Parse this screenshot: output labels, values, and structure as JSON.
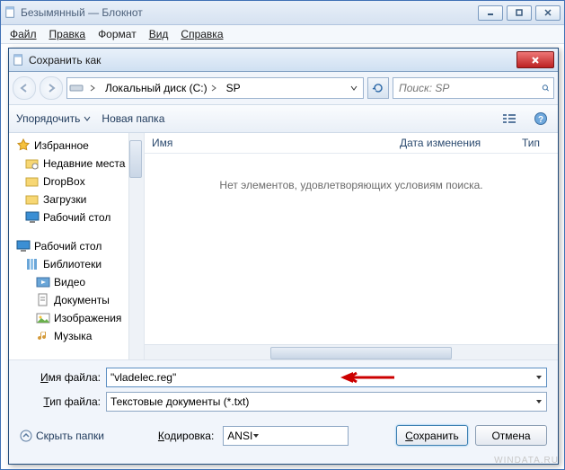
{
  "notepad": {
    "title": "Безымянный — Блокнот",
    "menu": [
      "Файл",
      "Правка",
      "Формат",
      "Вид",
      "Справка"
    ]
  },
  "dialog": {
    "title": "Сохранить как",
    "path": {
      "seg1": "Локальный диск (C:)",
      "seg2": "SP"
    },
    "search_placeholder": "Поиск: SP",
    "toolbar": {
      "organize": "Упорядочить",
      "new_folder": "Новая папка"
    },
    "columns": {
      "name": "Имя",
      "date": "Дата изменения",
      "type": "Тип"
    },
    "empty_msg": "Нет элементов, удовлетворяющих условиям поиска.",
    "tree": {
      "favorites": "Избранное",
      "recent": "Недавние места",
      "dropbox": "DropBox",
      "downloads": "Загрузки",
      "desktop1": "Рабочий стол",
      "desktop2": "Рабочий стол",
      "libraries": "Библиотеки",
      "video": "Видео",
      "documents": "Документы",
      "pictures": "Изображения",
      "music": "Музыка"
    },
    "form": {
      "filename_label": "Имя файла:",
      "filename_value": "\"vladelec.reg\"",
      "filetype_label": "Тип файла:",
      "filetype_value": "Текстовые документы (*.txt)"
    },
    "footer": {
      "hide": "Скрыть папки",
      "encoding_label": "Кодировка:",
      "encoding_value": "ANSI",
      "save": "Сохранить",
      "cancel": "Отмена"
    }
  },
  "watermark": "WINDATA.RU"
}
